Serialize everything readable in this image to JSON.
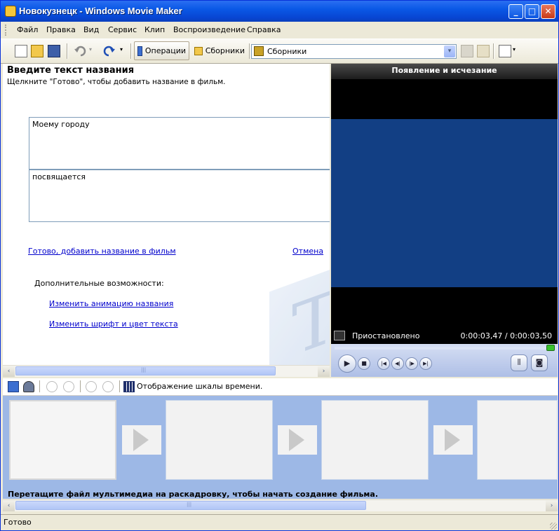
{
  "window": {
    "title": "Новокузнецк - Windows Movie Maker"
  },
  "title_buttons": {
    "minimize": "_",
    "maximize": "□",
    "close": "✕"
  },
  "menu": [
    "Файл",
    "Правка",
    "Вид",
    "Сервис",
    "Клип",
    "Воспроизведение",
    "Справка"
  ],
  "toolbar": {
    "operations_label": "Операции",
    "collections_label": "Сборники",
    "collections_combo_value": "Сборники",
    "combo_arrow": "▾"
  },
  "title_editor": {
    "heading": "Введите текст названия",
    "subheading": "Щелкните \"Готово\", чтобы добавить название в фильм.",
    "line1": "Моему городу",
    "line2": "посвящается",
    "done_link": "Готово, добавить название в фильм",
    "cancel_link": "Отмена",
    "more_options_label": "Дополнительные возможности:",
    "change_animation_link": "Изменить анимацию названия",
    "change_font_link": "Изменить шрифт и цвет текста",
    "watermark_letter": "T"
  },
  "player": {
    "title": "Появление и исчезание",
    "status": "Приостановлено",
    "time": "0:00:03,47 / 0:00:03,50",
    "seek_fraction": 0.99
  },
  "storyboard": {
    "toolbar_label": "Отображение шкалы времени.",
    "hint": "Перетащите файл мультимедиа на раскадровку, чтобы начать создание фильма."
  },
  "scroll": {
    "left": "‹",
    "right": "›",
    "grip": "|||"
  },
  "statusbar": {
    "text": "Готово"
  }
}
